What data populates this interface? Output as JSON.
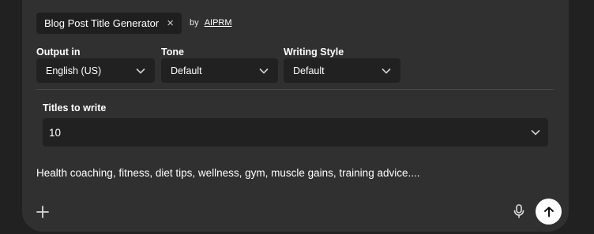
{
  "prompt_chip": {
    "label": "Blog Post Title Generator",
    "close_icon": "×",
    "by_text": "by",
    "author": "AIPRM"
  },
  "fields": {
    "output_in": {
      "label": "Output in",
      "value": "English (US)"
    },
    "tone": {
      "label": "Tone",
      "value": "Default"
    },
    "writing_style": {
      "label": "Writing Style",
      "value": "Default"
    },
    "titles_to_write": {
      "label": "Titles to write",
      "value": "10"
    }
  },
  "input": {
    "text": "Health coaching, fitness, diet tips, wellness, gym, muscle gains, training advice...."
  },
  "toolbar": {
    "add_icon": "plus-icon",
    "mic_icon": "microphone-icon",
    "send_icon": "arrow-up-icon"
  },
  "colors": {
    "page_bg": "#212121",
    "panel_bg": "#303030",
    "select_bg": "#212121",
    "text": "#ffffff",
    "send_bg": "#ffffff"
  }
}
